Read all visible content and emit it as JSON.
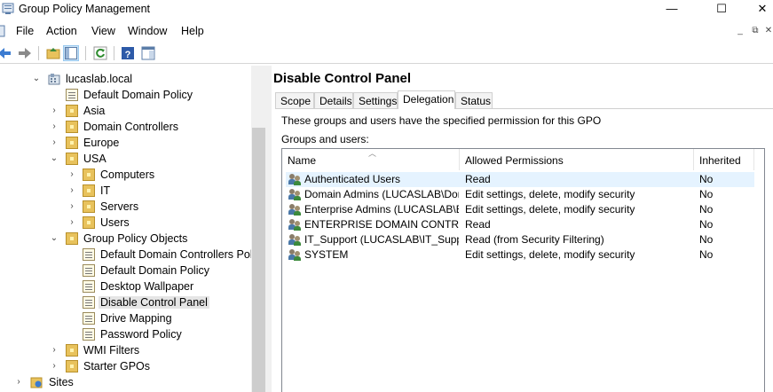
{
  "window": {
    "title": "Group Policy Management"
  },
  "window_controls": {
    "minimize": "—",
    "maximize": "☐",
    "close": "✕"
  },
  "menu": [
    "File",
    "Action",
    "View",
    "Window",
    "Help"
  ],
  "mdi_controls": {
    "minimize": "_",
    "restore": "⧉",
    "close": "✕"
  },
  "tree": {
    "domain": "lucaslab.local",
    "items": [
      {
        "label": "Default Domain Policy"
      },
      {
        "label": "Asia"
      },
      {
        "label": "Domain Controllers"
      },
      {
        "label": "Europe"
      },
      {
        "label": "USA"
      },
      {
        "label": "Computers"
      },
      {
        "label": "IT"
      },
      {
        "label": "Servers"
      },
      {
        "label": "Users"
      },
      {
        "label": "Group Policy Objects"
      },
      {
        "label": "Default Domain Controllers Poli"
      },
      {
        "label": "Default Domain Policy"
      },
      {
        "label": "Desktop Wallpaper"
      },
      {
        "label": "Disable Control Panel"
      },
      {
        "label": "Drive Mapping"
      },
      {
        "label": "Password Policy"
      },
      {
        "label": "WMI Filters"
      },
      {
        "label": "Starter GPOs"
      },
      {
        "label": "Sites"
      }
    ]
  },
  "detail": {
    "title": "Disable Control Panel",
    "tabs": [
      "Scope",
      "Details",
      "Settings",
      "Delegation",
      "Status"
    ],
    "active_tab": "Delegation",
    "info_text": "These groups and users have the specified permission for this GPO",
    "groups_label": "Groups and users:",
    "columns": [
      "Name",
      "Allowed Permissions",
      "Inherited"
    ],
    "rows": [
      {
        "name": "Authenticated Users",
        "perm": "Read",
        "inherited": "No"
      },
      {
        "name": "Domain Admins (LUCASLAB\\Dom...",
        "perm": "Edit settings, delete, modify security",
        "inherited": "No"
      },
      {
        "name": "Enterprise Admins (LUCASLAB\\En...",
        "perm": "Edit settings, delete, modify security",
        "inherited": "No"
      },
      {
        "name": "ENTERPRISE DOMAIN CONTRO...",
        "perm": "Read",
        "inherited": "No"
      },
      {
        "name": "IT_Support (LUCASLAB\\IT_Supp...",
        "perm": "Read (from Security Filtering)",
        "inherited": "No"
      },
      {
        "name": "SYSTEM",
        "perm": "Edit settings, delete, modify security",
        "inherited": "No"
      }
    ]
  }
}
